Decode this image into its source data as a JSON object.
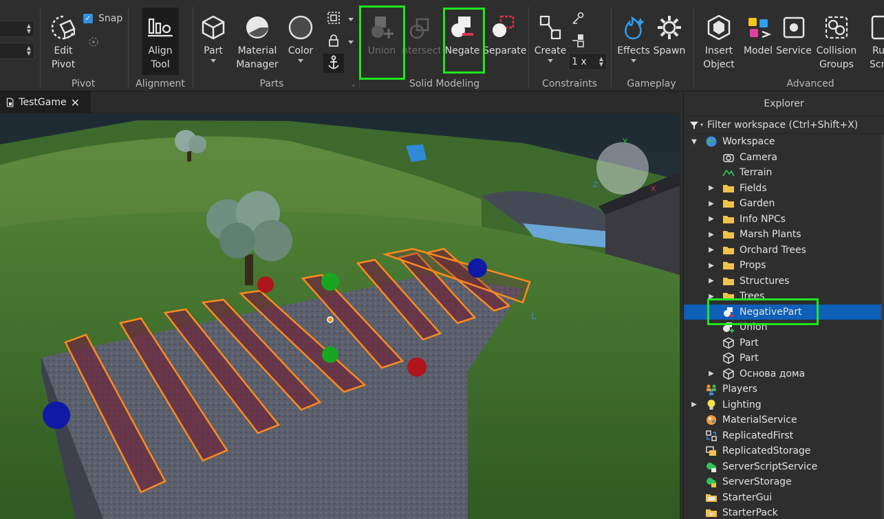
{
  "ribbon": {
    "snap_label": "Snap",
    "edit_pivot": [
      "Edit",
      "Pivot"
    ],
    "pivot_group": "Pivot",
    "align_tool": [
      "Align",
      "Tool"
    ],
    "alignment_group": "Alignment",
    "part": "Part",
    "material_manager": [
      "Material",
      "Manager"
    ],
    "color": "Color",
    "parts_group": "Parts",
    "union": "Union",
    "intersect": "Intersect",
    "negate": "Negate",
    "separate": "Separate",
    "solid_modeling_group": "Solid Modeling",
    "create": "Create",
    "scale_value": "1 x",
    "constraints_group": "Constraints",
    "effects": "Effects",
    "spawn": "Spawn",
    "gameplay_group": "Gameplay",
    "insert_object": [
      "Insert",
      "Object"
    ],
    "model": "Model",
    "service": "Service",
    "collision_groups": [
      "Collision",
      "Groups"
    ],
    "run_script": [
      "Ru",
      "Scr"
    ],
    "advanced_group": "Advanced",
    "colors": {
      "highlight": "#1ee81e",
      "selection": "#0d5fb8",
      "checkbox": "#2f8fe6"
    }
  },
  "tabs": [
    {
      "label": "TestGame"
    }
  ],
  "explorer": {
    "title": "Explorer",
    "filter_placeholder": "Filter workspace (Ctrl+Shift+X)",
    "items": [
      {
        "label": "Workspace",
        "icon": "globe-icon",
        "depth": 0,
        "expander": "expanded"
      },
      {
        "label": "Camera",
        "icon": "camera-icon",
        "depth": 1,
        "expander": "none"
      },
      {
        "label": "Terrain",
        "icon": "terrain-icon",
        "depth": 1,
        "expander": "none"
      },
      {
        "label": "Fields",
        "icon": "folder-icon",
        "depth": 1,
        "expander": "collapsed"
      },
      {
        "label": "Garden",
        "icon": "folder-icon",
        "depth": 1,
        "expander": "collapsed"
      },
      {
        "label": "Info NPCs",
        "icon": "folder-icon",
        "depth": 1,
        "expander": "collapsed"
      },
      {
        "label": "Marsh Plants",
        "icon": "folder-icon",
        "depth": 1,
        "expander": "collapsed"
      },
      {
        "label": "Orchard Trees",
        "icon": "folder-icon",
        "depth": 1,
        "expander": "collapsed"
      },
      {
        "label": "Props",
        "icon": "folder-icon",
        "depth": 1,
        "expander": "collapsed"
      },
      {
        "label": "Structures",
        "icon": "folder-icon",
        "depth": 1,
        "expander": "collapsed"
      },
      {
        "label": "Trees",
        "icon": "folder-icon",
        "depth": 1,
        "expander": "collapsed"
      },
      {
        "label": "NegativePart",
        "icon": "negative-part-icon",
        "depth": 1,
        "expander": "none",
        "selected": true
      },
      {
        "label": "Union",
        "icon": "union-icon",
        "depth": 1,
        "expander": "none"
      },
      {
        "label": "Part",
        "icon": "part-icon",
        "depth": 1,
        "expander": "none"
      },
      {
        "label": "Part",
        "icon": "part-icon",
        "depth": 1,
        "expander": "none"
      },
      {
        "label": "Основа дома",
        "icon": "part-icon",
        "depth": 1,
        "expander": "collapsed"
      },
      {
        "label": "Players",
        "icon": "players-icon",
        "depth": 0,
        "expander": "none"
      },
      {
        "label": "Lighting",
        "icon": "lightbulb-icon",
        "depth": 0,
        "expander": "collapsed"
      },
      {
        "label": "MaterialService",
        "icon": "material-service-icon",
        "depth": 0,
        "expander": "none"
      },
      {
        "label": "ReplicatedFirst",
        "icon": "replicated-first-icon",
        "depth": 0,
        "expander": "none"
      },
      {
        "label": "ReplicatedStorage",
        "icon": "replicated-storage-icon",
        "depth": 0,
        "expander": "none"
      },
      {
        "label": "ServerScriptService",
        "icon": "server-script-service-icon",
        "depth": 0,
        "expander": "none"
      },
      {
        "label": "ServerStorage",
        "icon": "server-storage-icon",
        "depth": 0,
        "expander": "none"
      },
      {
        "label": "StarterGui",
        "icon": "starter-gui-icon",
        "depth": 0,
        "expander": "none"
      },
      {
        "label": "StarterPack",
        "icon": "starter-pack-icon",
        "depth": 0,
        "expander": "none"
      }
    ]
  }
}
